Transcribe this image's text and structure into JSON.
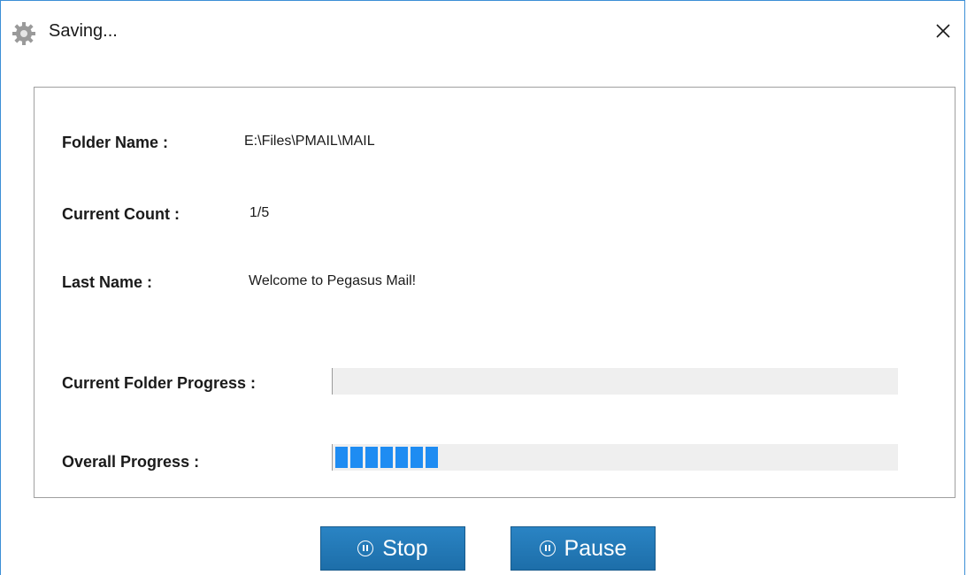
{
  "window": {
    "title": "Saving...",
    "close_glyph": "✕",
    "icon": "gear-icon"
  },
  "fields": {
    "folder_name_label": "Folder Name :",
    "folder_name_value": "E:\\Files\\PMAIL\\MAIL",
    "current_count_label": "Current Count :",
    "current_count_value": "1/5",
    "last_name_label": "Last Name :",
    "last_name_value": "Welcome to Pegasus Mail!"
  },
  "progress": {
    "current_folder_label": "Current Folder Progress :",
    "current_folder_fraction": 0,
    "overall_label": "Overall Progress :",
    "overall_blocks_filled": 7,
    "fill_color": "#1e8cf2"
  },
  "buttons": {
    "stop_label": "Stop",
    "pause_label": "Pause",
    "button_color": "#1f74b2",
    "icon": "pause-circle-icon"
  }
}
